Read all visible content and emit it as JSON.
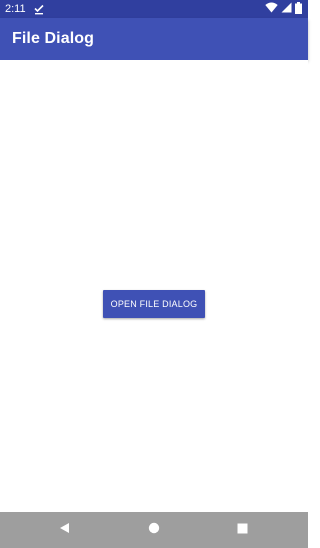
{
  "status_bar": {
    "time": "2:11",
    "notification_icon": "download-done-icon",
    "icons": [
      "wifi-icon",
      "cellular-signal-icon",
      "battery-icon"
    ]
  },
  "app_bar": {
    "title": "File Dialog",
    "color": "#3f51b5",
    "status_color": "#303f9f"
  },
  "main": {
    "open_button_label": "OPEN FILE DIALOG",
    "button_color": "#3f51b5"
  },
  "nav_bar": {
    "buttons": [
      "back-icon",
      "home-icon",
      "recents-icon"
    ],
    "color": "#9e9e9e"
  }
}
